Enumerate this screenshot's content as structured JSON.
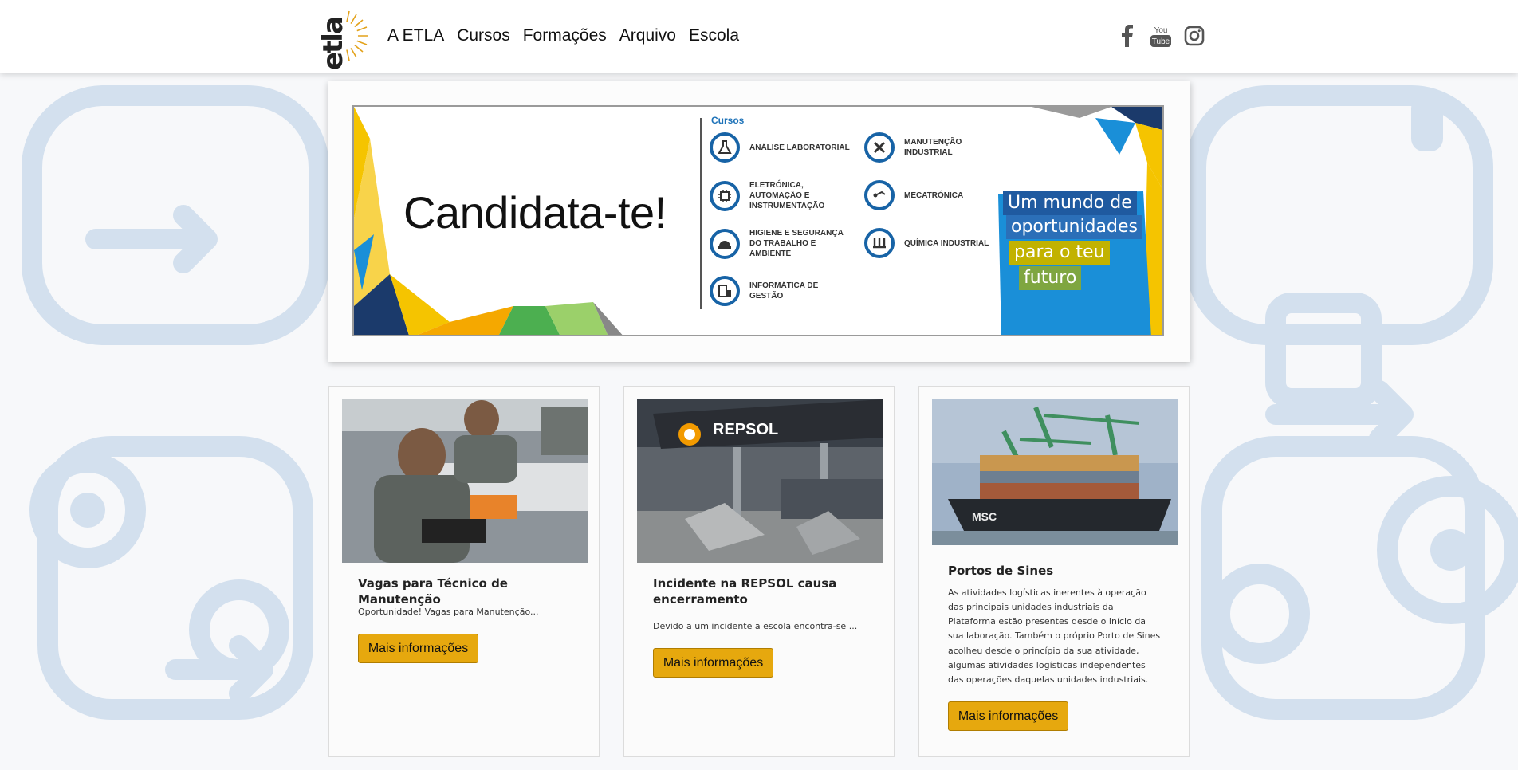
{
  "brand": {
    "logo_text": "etla"
  },
  "nav": {
    "items": [
      {
        "label": "A ETLA"
      },
      {
        "label": "Cursos"
      },
      {
        "label": "Formações"
      },
      {
        "label": "Arquivo"
      },
      {
        "label": "Escola"
      }
    ]
  },
  "social": {
    "icons": [
      "facebook-icon",
      "youtube-icon",
      "instagram-icon"
    ],
    "youtube_text": [
      "You",
      "Tube"
    ]
  },
  "banner": {
    "title": "Candidata-te!",
    "courses_heading": "Cursos",
    "courses": [
      {
        "label": "ANÁLISE LABORATORIAL",
        "icon": "flask-icon"
      },
      {
        "label": "MANUTENÇÃO INDUSTRIAL",
        "icon": "tools-icon"
      },
      {
        "label": "ELETRÓNICA, AUTOMAÇÃO E INSTRUMENTAÇÃO",
        "icon": "circuit-icon"
      },
      {
        "label": "MECATRÓNICA",
        "icon": "robot-arm-icon"
      },
      {
        "label": "HIGIENE E SEGURANÇA DO TRABALHO E AMBIENTE",
        "icon": "safety-helmet-icon"
      },
      {
        "label": "QUÍMICA INDUSTRIAL",
        "icon": "test-tubes-icon"
      },
      {
        "label": "INFORMÁTICA DE GESTÃO",
        "icon": "computer-icon"
      }
    ],
    "slogan": [
      "Um mundo de",
      "oportunidades",
      "para o teu",
      "futuro"
    ],
    "colors": {
      "blue": "#1a8fd8",
      "yellow": "#f5c400",
      "green": "#4caf50",
      "dark_blue": "#1b3a6b"
    }
  },
  "cards": [
    {
      "title": "Vagas para Técnico de Manutenção",
      "text": "Oportunidade! Vagas para Manutenção...",
      "button": "Mais informações"
    },
    {
      "title": "Incidente na REPSOL causa encerramento",
      "text": "Devido a um incidente a escola encontra-se ...",
      "button": "Mais informações",
      "image_sign": "REPSOL"
    },
    {
      "title": "Portos de Sines",
      "text": "As atividades logísticas inerentes à operação das principais unidades industriais da Plataforma estão presentes desde o início da sua laboração. Também o próprio Porto de Sines acolheu desde o princípio da sua atividade, algumas atividades logísticas independentes das operações daquelas unidades industriais.",
      "button": "Mais informações",
      "image_sign": "MSC"
    }
  ],
  "theme": {
    "accent": "#e6a80e",
    "background_pattern": "#c5d5e8"
  }
}
